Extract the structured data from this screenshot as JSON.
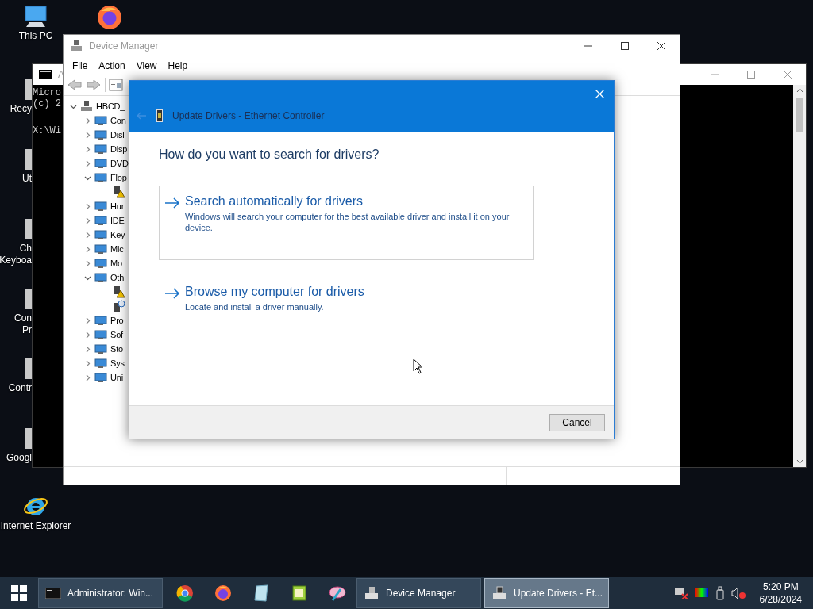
{
  "desktop": {
    "icons": [
      {
        "label": "This PC"
      }
    ],
    "partly_hidden_icons": [
      {
        "lines": [
          "Recy"
        ]
      },
      {
        "lines": [
          "Ut"
        ]
      },
      {
        "lines": [
          "Ch",
          "Keyboa"
        ]
      },
      {
        "lines": [
          "Con",
          "Pr"
        ]
      },
      {
        "lines": [
          "Contr"
        ]
      },
      {
        "lines": [
          "Googl"
        ]
      }
    ],
    "bottom_icons": [
      {
        "label": "Internet Explorer"
      }
    ]
  },
  "console_window": {
    "title": "A",
    "paragraphs": [
      [
        "Micro",
        "(c) 2"
      ],
      [
        "X:\\Wi"
      ]
    ]
  },
  "device_manager": {
    "title": "Device Manager",
    "menu": [
      "File",
      "Action",
      "View",
      "Help"
    ],
    "tree": {
      "label": "HBCD_",
      "expanded": true,
      "children": [
        {
          "label": "Con",
          "expanded": false
        },
        {
          "label": "Disl",
          "expanded": false
        },
        {
          "label": "Disp",
          "expanded": false
        },
        {
          "label": "DVD",
          "expanded": false
        },
        {
          "label": "Flop",
          "expanded": true,
          "children": [
            {
              "kind": "warning"
            }
          ]
        },
        {
          "label": "Hur",
          "expanded": false
        },
        {
          "label": "IDE",
          "expanded": false
        },
        {
          "label": "Key",
          "expanded": false
        },
        {
          "label": "Mic",
          "expanded": false
        },
        {
          "label": "Mo",
          "expanded": false
        },
        {
          "label": "Oth",
          "expanded": true,
          "children": [
            {
              "kind": "warning"
            },
            {
              "kind": "unknown"
            }
          ]
        },
        {
          "label": "Pro",
          "expanded": false
        },
        {
          "label": "Sof",
          "expanded": false
        },
        {
          "label": "Sto",
          "expanded": false
        },
        {
          "label": "Sys",
          "expanded": false
        },
        {
          "label": "Uni",
          "expanded": false
        }
      ]
    }
  },
  "dialog": {
    "title": "Update Drivers - Ethernet Controller",
    "heading": "How do you want to search for drivers?",
    "options": [
      {
        "title": "Search automatically for drivers",
        "description": "Windows will search your computer for the best available driver and install it on your device.",
        "selected": true
      },
      {
        "title": "Browse my computer for drivers",
        "description": "Locate and install a driver manually.",
        "selected": false
      }
    ],
    "cancel": "Cancel"
  },
  "taskbar": {
    "windows": [
      {
        "label": "Administrator: Win...",
        "active": false
      },
      {
        "label": "Device Manager",
        "active": false
      },
      {
        "label": "Update Drivers - Et...",
        "active": true
      }
    ],
    "clock": {
      "time": "5:20 PM",
      "date": "6/28/2024"
    }
  }
}
